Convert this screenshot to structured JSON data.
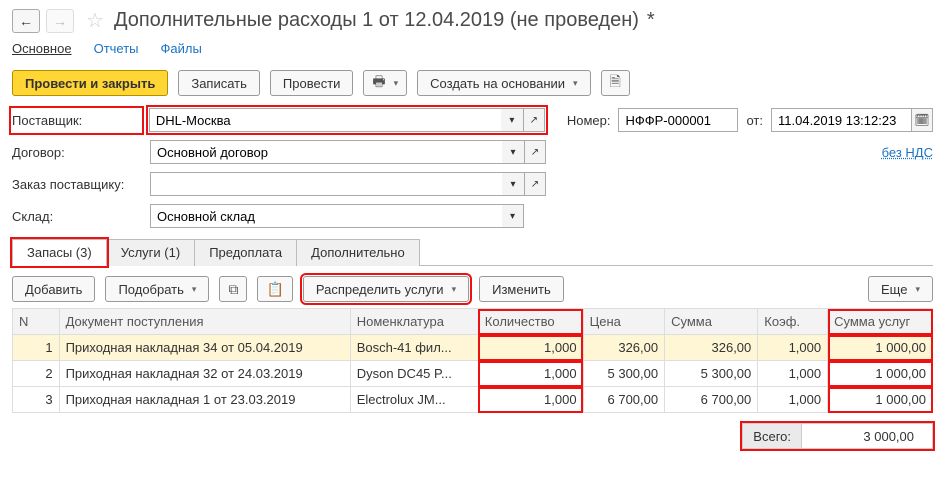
{
  "title_main": "Дополнительные расходы 1 от 12.04.2019 (не проведен)",
  "title_mod": "*",
  "nav": {
    "main": "Основное",
    "reports": "Отчеты",
    "files": "Файлы"
  },
  "toolbar": {
    "post_close": "Провести и закрыть",
    "save": "Записать",
    "post": "Провести",
    "create_based": "Создать на основании"
  },
  "fields": {
    "supplier_label": "Поставщик:",
    "supplier_value": "DHL-Москва",
    "number_label": "Номер:",
    "number_value": "НФФР-000001",
    "from_label": "от:",
    "date_value": "11.04.2019 13:12:23",
    "contract_label": "Договор:",
    "contract_value": "Основной договор",
    "vat_link": "без НДС",
    "order_label": "Заказ поставщику:",
    "order_value": "",
    "warehouse_label": "Склад:",
    "warehouse_value": "Основной склад"
  },
  "tabs": {
    "inventory": "Запасы (3)",
    "services": "Услуги (1)",
    "prepay": "Предоплата",
    "extra": "Дополнительно"
  },
  "tableToolbar": {
    "add": "Добавить",
    "pick": "Подобрать",
    "distribute": "Распределить услуги",
    "edit": "Изменить",
    "more": "Еще"
  },
  "columns": {
    "n": "N",
    "doc": "Документ поступления",
    "nom": "Номенклатура",
    "qty": "Количество",
    "price": "Цена",
    "sum": "Сумма",
    "coef": "Коэф.",
    "serv_sum": "Сумма услуг"
  },
  "rows": [
    {
      "n": "1",
      "doc": "Приходная накладная 34 от 05.04.2019",
      "nom": "Bosch-41 фил...",
      "qty": "1,000",
      "price": "326,00",
      "sum": "326,00",
      "coef": "1,000",
      "serv_sum": "1 000,00"
    },
    {
      "n": "2",
      "doc": "Приходная накладная 32 от 24.03.2019",
      "nom": "Dyson DC45 P...",
      "qty": "1,000",
      "price": "5 300,00",
      "sum": "5 300,00",
      "coef": "1,000",
      "serv_sum": "1 000,00"
    },
    {
      "n": "3",
      "doc": "Приходная накладная 1 от 23.03.2019",
      "nom": "Electrolux JM...",
      "qty": "1,000",
      "price": "6 700,00",
      "sum": "6 700,00",
      "coef": "1,000",
      "serv_sum": "1 000,00"
    }
  ],
  "footer": {
    "total_label": "Всего:",
    "total_value": "3 000,00"
  }
}
